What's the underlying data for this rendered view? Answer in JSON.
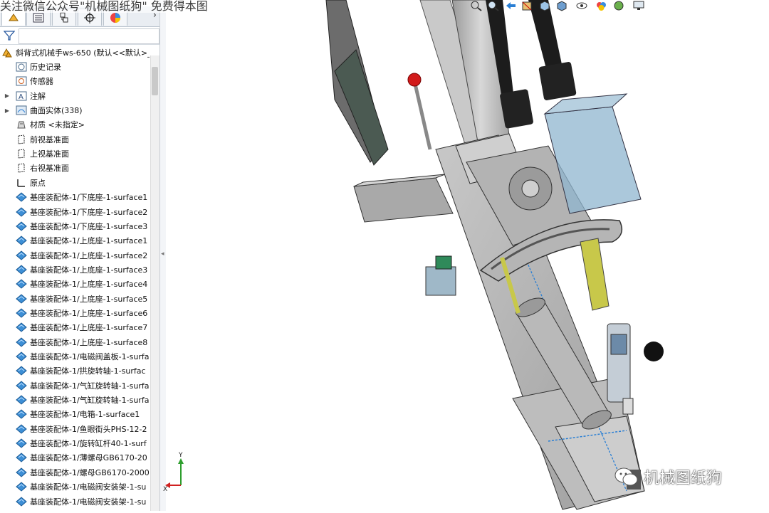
{
  "watermark_top": "关注微信公众号\"机械图纸狗\" 免费得本图",
  "watermark_logo": "机械图纸狗",
  "filter": {
    "placeholder": ""
  },
  "tabs": [
    "feature-manager",
    "property-manager",
    "configuration-manager",
    "dimxpert-manager",
    "display-manager"
  ],
  "tree": {
    "root": "斜背式机械手ws-650  (默认<<默认>_",
    "items": [
      {
        "label": "历史记录",
        "icon": "history-icon",
        "expand": false
      },
      {
        "label": "传感器",
        "icon": "sensor-icon",
        "expand": false
      },
      {
        "label": "注解",
        "icon": "annotation-icon",
        "expand": true
      },
      {
        "label": "曲面实体(338)",
        "icon": "surface-bodies-icon",
        "expand": true
      },
      {
        "label": "材质 <未指定>",
        "icon": "material-icon",
        "expand": false
      },
      {
        "label": "前视基准面",
        "icon": "plane-icon",
        "expand": false
      },
      {
        "label": "上视基准面",
        "icon": "plane-icon",
        "expand": false
      },
      {
        "label": "右视基准面",
        "icon": "plane-icon",
        "expand": false
      },
      {
        "label": "原点",
        "icon": "origin-icon",
        "expand": false
      },
      {
        "label": "基座装配体-1/下底座-1-surface1",
        "icon": "surface-feature-icon",
        "expand": false
      },
      {
        "label": "基座装配体-1/下底座-1-surface2",
        "icon": "surface-feature-icon",
        "expand": false
      },
      {
        "label": "基座装配体-1/下底座-1-surface3",
        "icon": "surface-feature-icon",
        "expand": false
      },
      {
        "label": "基座装配体-1/上底座-1-surface1",
        "icon": "surface-feature-icon",
        "expand": false
      },
      {
        "label": "基座装配体-1/上底座-1-surface2",
        "icon": "surface-feature-icon",
        "expand": false
      },
      {
        "label": "基座装配体-1/上底座-1-surface3",
        "icon": "surface-feature-icon",
        "expand": false
      },
      {
        "label": "基座装配体-1/上底座-1-surface4",
        "icon": "surface-feature-icon",
        "expand": false
      },
      {
        "label": "基座装配体-1/上底座-1-surface5",
        "icon": "surface-feature-icon",
        "expand": false
      },
      {
        "label": "基座装配体-1/上底座-1-surface6",
        "icon": "surface-feature-icon",
        "expand": false
      },
      {
        "label": "基座装配体-1/上底座-1-surface7",
        "icon": "surface-feature-icon",
        "expand": false
      },
      {
        "label": "基座装配体-1/上底座-1-surface8",
        "icon": "surface-feature-icon",
        "expand": false
      },
      {
        "label": "基座装配体-1/电磁阀盖板-1-surfa",
        "icon": "surface-feature-icon",
        "expand": false
      },
      {
        "label": "基座装配体-1/拱旋转轴-1-surfac",
        "icon": "surface-feature-icon",
        "expand": false
      },
      {
        "label": "基座装配体-1/气缸旋转轴-1-surfa",
        "icon": "surface-feature-icon",
        "expand": false
      },
      {
        "label": "基座装配体-1/气缸旋转轴-1-surfa",
        "icon": "surface-feature-icon",
        "expand": false
      },
      {
        "label": "基座装配体-1/电箱-1-surface1",
        "icon": "surface-feature-icon",
        "expand": false
      },
      {
        "label": "基座装配体-1/鱼眼街头PHS-12-2",
        "icon": "surface-feature-icon",
        "expand": false
      },
      {
        "label": "基座装配体-1/旋转缸杆40-1-surf",
        "icon": "surface-feature-icon",
        "expand": false
      },
      {
        "label": "基座装配体-1/薄螺母GB6170-20",
        "icon": "surface-feature-icon",
        "expand": false
      },
      {
        "label": "基座装配体-1/螺母GB6170-2000",
        "icon": "surface-feature-icon",
        "expand": false
      },
      {
        "label": "基座装配体-1/电磁阀安装架-1-su",
        "icon": "surface-feature-icon",
        "expand": false
      },
      {
        "label": "基座装配体-1/电磁阀安装架-1-su",
        "icon": "surface-feature-icon",
        "expand": false
      }
    ]
  },
  "triad": {
    "x": "X",
    "y": "Y"
  },
  "colors": {
    "accent": "#2a7fd4",
    "machine_gray": "#b8b8b8",
    "glass_blue": "#8fb6cf",
    "cylinder_yellow": "#c8c84a"
  }
}
